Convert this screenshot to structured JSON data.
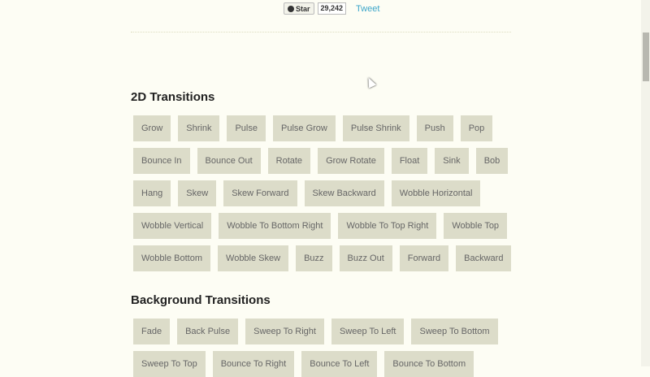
{
  "header": {
    "star_label": "Star",
    "star_count": "29,242",
    "tweet_label": "Tweet"
  },
  "sections": [
    {
      "title": "2D Transitions",
      "buttons": [
        "Grow",
        "Shrink",
        "Pulse",
        "Pulse Grow",
        "Pulse Shrink",
        "Push",
        "Pop",
        "Bounce In",
        "Bounce Out",
        "Rotate",
        "Grow Rotate",
        "Float",
        "Sink",
        "Bob",
        "Hang",
        "Skew",
        "Skew Forward",
        "Skew Backward",
        "Wobble Horizontal",
        "Wobble Vertical",
        "Wobble To Bottom Right",
        "Wobble To Top Right",
        "Wobble Top",
        "Wobble Bottom",
        "Wobble Skew",
        "Buzz",
        "Buzz Out",
        "Forward",
        "Backward"
      ]
    },
    {
      "title": "Background Transitions",
      "buttons": [
        "Fade",
        "Back Pulse",
        "Sweep To Right",
        "Sweep To Left",
        "Sweep To Bottom",
        "Sweep To Top",
        "Bounce To Right",
        "Bounce To Left",
        "Bounce To Bottom"
      ]
    }
  ]
}
